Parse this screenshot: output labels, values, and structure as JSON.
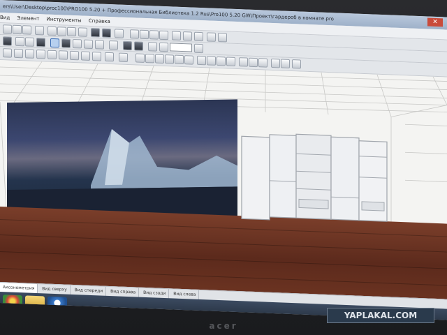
{
  "window": {
    "title": "ers\\User\\Desktop\\proc100\\PRO100 5.20 + Профессиональная Библиотека 1.2 Rus\\Pro100 5.20 GW\\Проект\\гардероб в комнате.pro",
    "close_glyph": "✕"
  },
  "menu": {
    "items": [
      "Вид",
      "Элемент",
      "Инструменты",
      "Справка"
    ]
  },
  "toolbar": {
    "zoom_value": "",
    "zoom_in_icon": "zoom-in-icon"
  },
  "views": {
    "tabs": [
      "Аксонометрия",
      "Вид сверху",
      "Вид спереди",
      "Вид справа",
      "Вид сзади",
      "Вид слева"
    ],
    "active_index": 0
  },
  "taskbar": {
    "icons": [
      "chrome-icon",
      "folder-icon",
      "pro100-icon"
    ]
  },
  "bezel": {
    "brand": "acer"
  },
  "watermark": {
    "text": "YAPLAKAL.COM"
  }
}
